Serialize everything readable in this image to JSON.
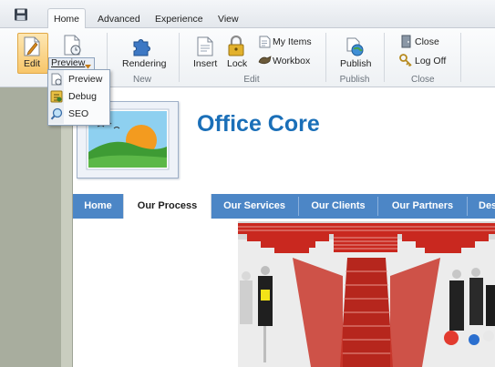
{
  "tabs": [
    {
      "label": "Home",
      "active": true
    },
    {
      "label": "Advanced",
      "active": false
    },
    {
      "label": "Experience",
      "active": false
    },
    {
      "label": "View",
      "active": false
    }
  ],
  "ribbon": {
    "edit_label": "Edit",
    "preview_label": "Preview",
    "rendering_label": "Rendering",
    "insert_label": "Insert",
    "lock_label": "Lock",
    "my_items_label": "My Items",
    "workbox_label": "Workbox",
    "publish_label": "Publish",
    "close_label": "Close",
    "log_off_label": "Log Off",
    "group_new": "New",
    "group_edit": "Edit",
    "group_publish": "Publish",
    "group_close": "Close"
  },
  "preview_menu": {
    "items": [
      {
        "label": "Preview",
        "icon": "preview-page-icon"
      },
      {
        "label": "Debug",
        "icon": "debug-icon"
      },
      {
        "label": "SEO",
        "icon": "seo-icon"
      }
    ]
  },
  "site": {
    "title": "Office Core",
    "nav": [
      "Home",
      "Our Process",
      "Our Services",
      "Our Clients",
      "Our Partners",
      "Des"
    ],
    "active_nav": "Our Process"
  },
  "colors": {
    "brand_blue": "#1a6fb8",
    "nav_blue": "#4c86c6",
    "edit_highlight": "#f8c66a"
  }
}
